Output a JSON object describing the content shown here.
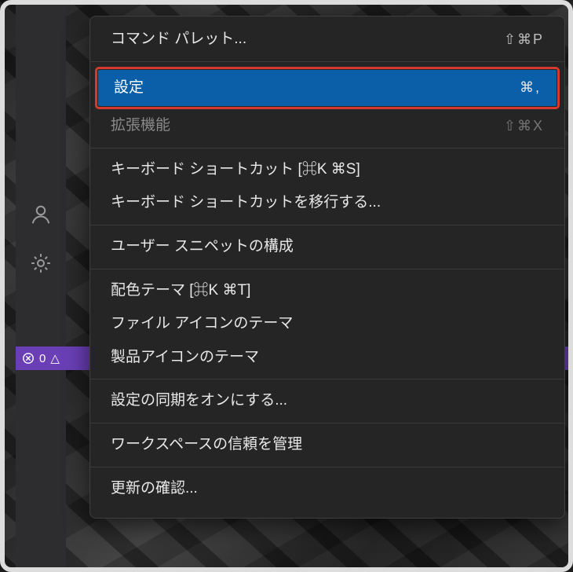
{
  "activityBar": {
    "icons": {
      "account": "account-icon",
      "settings": "gear-icon"
    }
  },
  "statusBar": {
    "errors": "0",
    "warnings_glyph": "△"
  },
  "menu": {
    "groups": [
      [
        {
          "label": "コマンド パレット...",
          "shortcut": "⇧⌘P",
          "disabled": false
        }
      ],
      [
        {
          "label": "設定",
          "shortcut": "⌘,",
          "disabled": false,
          "highlighted": true
        },
        {
          "label": "拡張機能",
          "shortcut": "⇧⌘X",
          "disabled": true
        }
      ],
      [
        {
          "label": "キーボード ショートカット [⌘K ⌘S]",
          "shortcut": "",
          "disabled": false
        },
        {
          "label": "キーボード ショートカットを移行する...",
          "shortcut": "",
          "disabled": false
        }
      ],
      [
        {
          "label": "ユーザー スニペットの構成",
          "shortcut": "",
          "disabled": false
        }
      ],
      [
        {
          "label": "配色テーマ [⌘K ⌘T]",
          "shortcut": "",
          "disabled": false
        },
        {
          "label": "ファイル アイコンのテーマ",
          "shortcut": "",
          "disabled": false
        },
        {
          "label": "製品アイコンのテーマ",
          "shortcut": "",
          "disabled": false
        }
      ],
      [
        {
          "label": "設定の同期をオンにする...",
          "shortcut": "",
          "disabled": false
        }
      ],
      [
        {
          "label": "ワークスペースの信頼を管理",
          "shortcut": "",
          "disabled": false
        }
      ],
      [
        {
          "label": "更新の確認...",
          "shortcut": "",
          "disabled": false
        }
      ]
    ]
  }
}
